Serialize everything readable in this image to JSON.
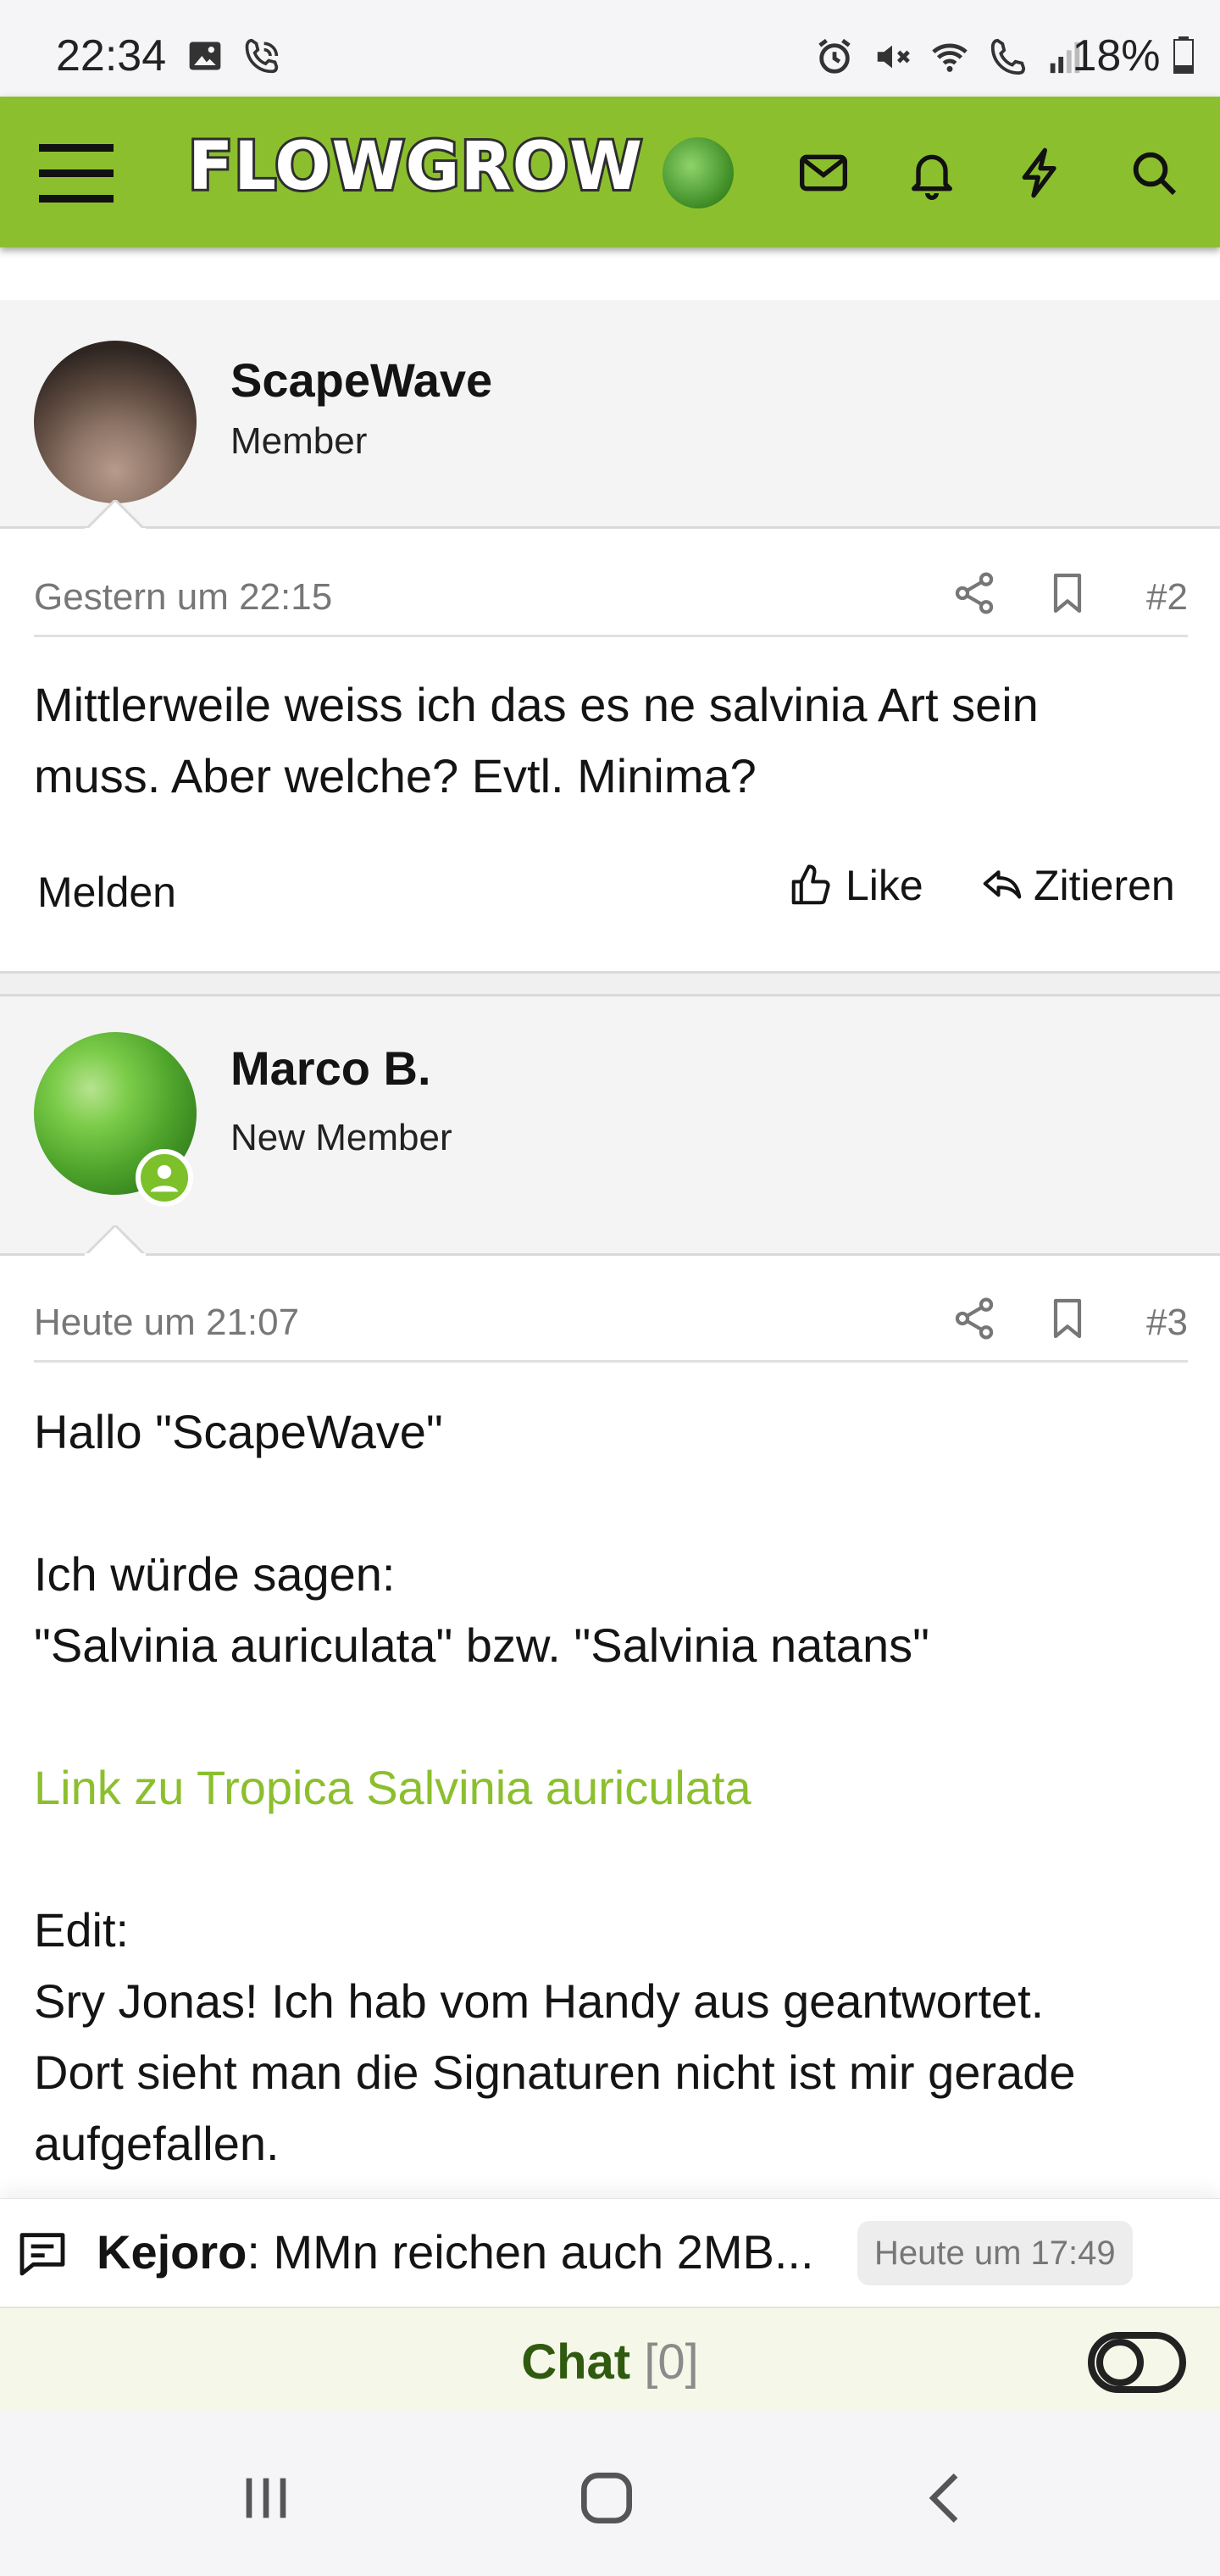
{
  "status_bar": {
    "time": "22:34",
    "battery": "18%",
    "left_icons": [
      "image-icon",
      "wifi-call-icon"
    ],
    "right_icons": [
      "alarm-icon",
      "mute-icon",
      "wifi-icon",
      "call-signal-icon",
      "signal-icon",
      "battery-icon"
    ]
  },
  "app_bar": {
    "logo": "FLOWGROW",
    "icons": [
      "menu-icon",
      "avatar",
      "mail-icon",
      "bell-icon",
      "lightning-icon",
      "search-icon"
    ],
    "accent": "#8cbf2e"
  },
  "posts": [
    {
      "username": "ScapeWave",
      "role": "Member",
      "date": "Gestern um 22:15",
      "number": "#2",
      "text_lines": [
        "Mittlerweile weiss ich das es ne salvinia Art sein",
        "muss. Aber welche? Evtl. Minima?"
      ],
      "report": "Melden",
      "like": "Like",
      "quote": "Zitieren"
    },
    {
      "username": "Marco B.",
      "role": "New Member",
      "date": "Heute um 21:07",
      "number": "#3",
      "greeting": "Hallo \"ScapeWave\"",
      "line1": "Ich würde sagen:",
      "line2": "\"Salvinia auriculata\" bzw. \"Salvinia natans\"",
      "link": "Link zu Tropica Salvinia auriculata",
      "edit": "Edit:",
      "edit_lines": [
        "Sry Jonas! Ich hab vom Handy aus geantwortet.",
        "Dort sieht man die Signaturen nicht ist mir gerade",
        "aufgefallen."
      ]
    }
  ],
  "chat_preview": {
    "user": "Kejoro",
    "message": ": MMn reichen auch 2MB...",
    "time": "Heute um 17:49"
  },
  "chat_bar": {
    "label": "Chat",
    "count": "[0]"
  },
  "nav_bar": {
    "buttons": [
      "recent-apps-icon",
      "home-icon",
      "back-icon"
    ]
  }
}
